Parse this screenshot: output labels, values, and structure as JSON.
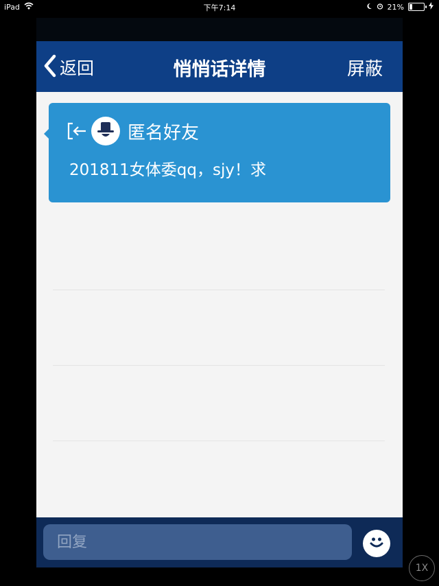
{
  "status_bar": {
    "device": "iPad",
    "time": "下午7:14",
    "battery": "21%",
    "battery_level": 0.21
  },
  "navbar": {
    "back_label": "返回",
    "title": "悄悄话详情",
    "block_label": "屏蔽",
    "bg_color": "#0e3f86"
  },
  "message": {
    "sender": "匿名好友",
    "text": "201811女体委qq，sjy！求",
    "bg_color": "#2a93d2"
  },
  "reply": {
    "placeholder": "回复"
  },
  "zoom": {
    "label": "1X"
  }
}
